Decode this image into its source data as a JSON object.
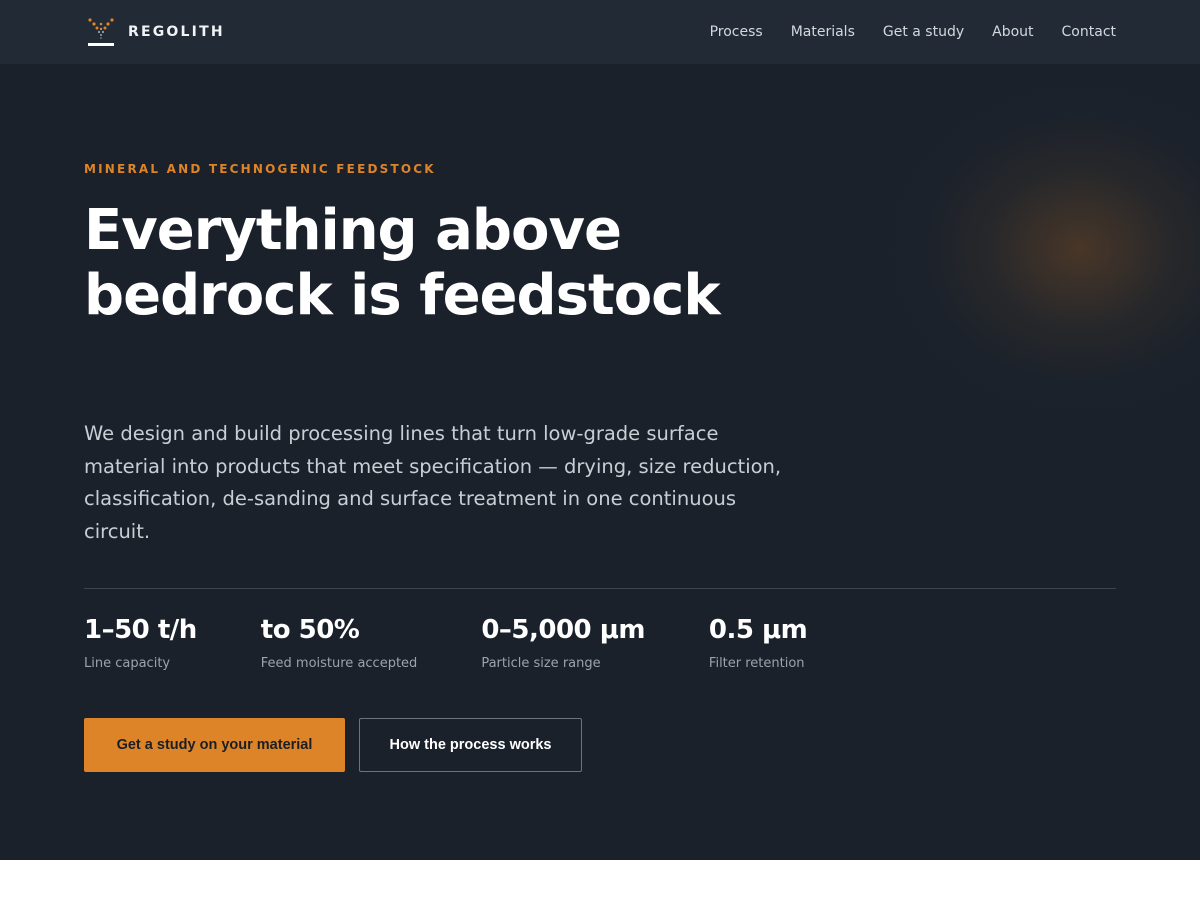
{
  "brand": {
    "name": "REGOLITH",
    "logo_icon": "sieve-dots-icon",
    "accent": "#dd8428"
  },
  "nav": {
    "links": [
      "Process",
      "Materials",
      "Get a study",
      "About",
      "Contact"
    ]
  },
  "hero": {
    "eyebrow": "MINERAL AND TECHNOGENIC FEEDSTOCK",
    "headline": "Everything above bedrock is feedstock",
    "lead": "We design and build processing lines that turn low-grade surface material into products that meet specification — drying, size reduction, classification, de-sanding and surface treatment in one continuous circuit.",
    "stats": [
      {
        "value": "1–50 t/h",
        "label": "Line capacity"
      },
      {
        "value": "to 50%",
        "label": "Feed moisture accepted"
      },
      {
        "value": "0–5,000 μm",
        "label": "Particle size range"
      },
      {
        "value": "0.5 μm",
        "label": "Filter retention"
      }
    ],
    "cta_primary": "Get a study on your material",
    "cta_secondary": "How the process works"
  },
  "colors": {
    "nav_bg": "#212a35",
    "hero_bg": "#1a212b",
    "accent": "#dd8428"
  }
}
